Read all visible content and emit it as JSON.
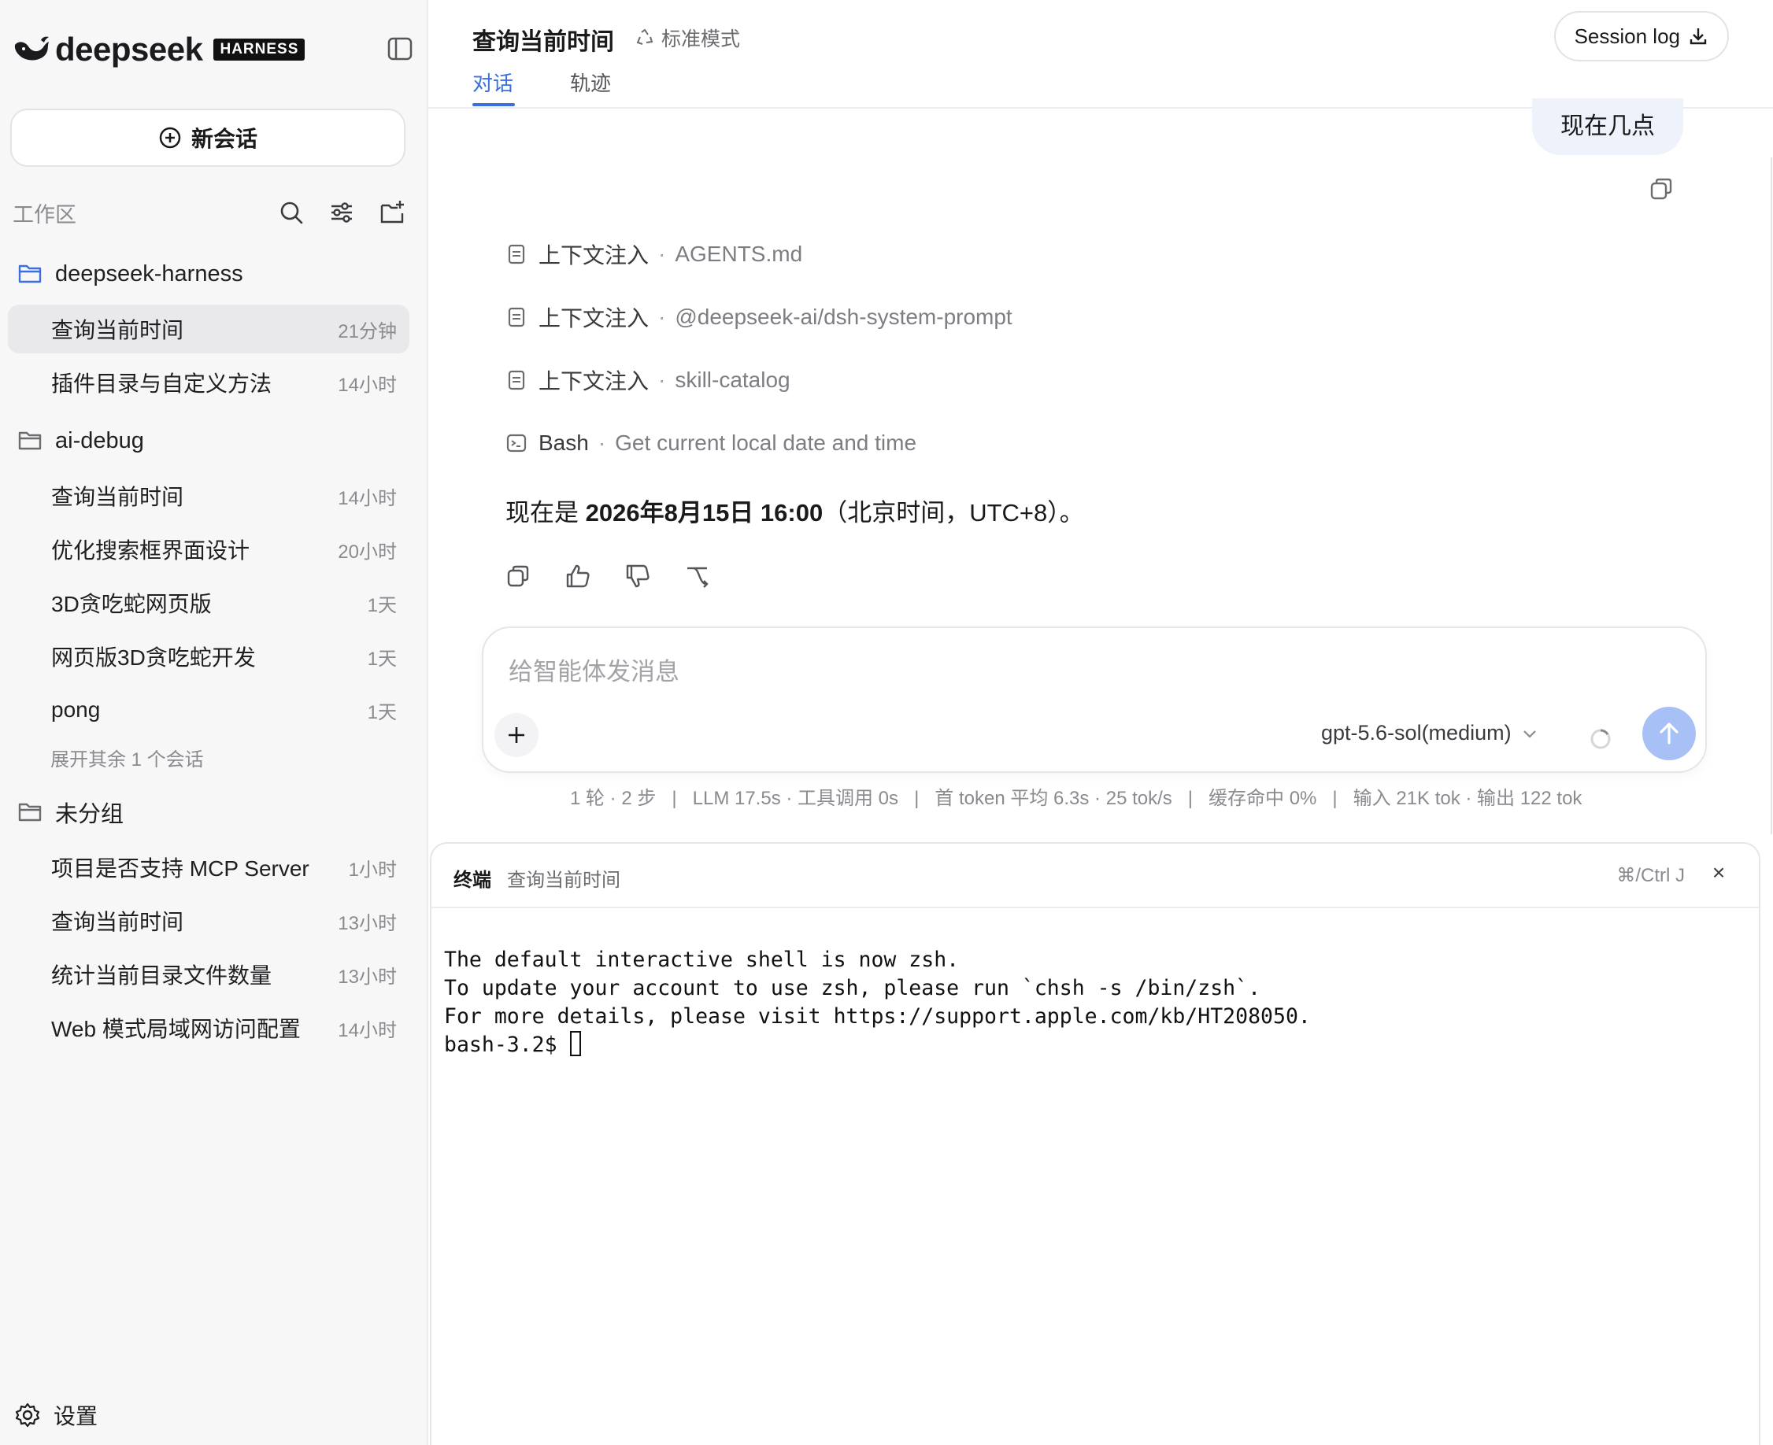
{
  "brand": {
    "name": "deepseek",
    "badge": "HARNESS"
  },
  "sidebar": {
    "new_chat_label": "新会话",
    "workspace_label": "工作区",
    "groups": [
      {
        "name": "deepseek-harness",
        "items": [
          {
            "title": "查询当前时间",
            "time": "21分钟",
            "active": true
          },
          {
            "title": "插件目录与自定义方法",
            "time": "14小时"
          }
        ]
      },
      {
        "name": "ai-debug",
        "items": [
          {
            "title": "查询当前时间",
            "time": "14小时"
          },
          {
            "title": "优化搜索框界面设计",
            "time": "20小时"
          },
          {
            "title": "3D贪吃蛇网页版",
            "time": "1天"
          },
          {
            "title": "网页版3D贪吃蛇开发",
            "time": "1天"
          },
          {
            "title": "pong",
            "time": "1天"
          }
        ],
        "more": "展开其余 1 个会话"
      },
      {
        "name": "未分组",
        "items": [
          {
            "title": "项目是否支持 MCP Server",
            "time": "1小时"
          },
          {
            "title": "查询当前时间",
            "time": "13小时"
          },
          {
            "title": "统计当前目录文件数量",
            "time": "13小时"
          },
          {
            "title": "Web 模式局域网访问配置",
            "time": "14小时"
          }
        ]
      }
    ],
    "settings_label": "设置"
  },
  "header": {
    "title": "查询当前时间",
    "mode": "标准模式",
    "tabs": [
      "对话",
      "轨迹"
    ],
    "active_tab": "对话",
    "session_log_label": "Session log"
  },
  "conversation": {
    "user_message": "现在几点",
    "steps": [
      {
        "kind": "上下文注入",
        "detail": "AGENTS.md"
      },
      {
        "kind": "上下文注入",
        "detail": "@deepseek-ai/dsh-system-prompt"
      },
      {
        "kind": "上下文注入",
        "detail": "skill-catalog"
      },
      {
        "kind": "Bash",
        "detail": "Get current local date and time"
      }
    ],
    "answer_prefix": "现在是 ",
    "answer_bold": "2026年8月15日 16:00",
    "answer_suffix": "（北京时间，UTC+8）。"
  },
  "composer": {
    "placeholder": "给智能体发消息",
    "model": "gpt-5.6-sol(medium)"
  },
  "stats": {
    "turns": "1 轮 · 2 步",
    "llm": "LLM 17.5s · 工具调用 0s",
    "token": "首 token 平均 6.3s · 25 tok/s",
    "cache": "缓存命中 0%",
    "io": "输入 21K tok · 输出 122 tok",
    "separator": "|"
  },
  "terminal": {
    "label": "终端",
    "session": "查询当前时间",
    "shortcut": "⌘/Ctrl J",
    "close": "×",
    "lines": [
      "The default interactive shell is now zsh.",
      "To update your account to use zsh, please run `chsh -s /bin/zsh`.",
      "For more details, please visit https://support.apple.com/kb/HT208050."
    ],
    "prompt": "bash-3.2$ "
  },
  "colors": {
    "accent": "#3b6fe0",
    "send_button": "#a7c0f5",
    "user_bubble": "#eef2fb"
  }
}
